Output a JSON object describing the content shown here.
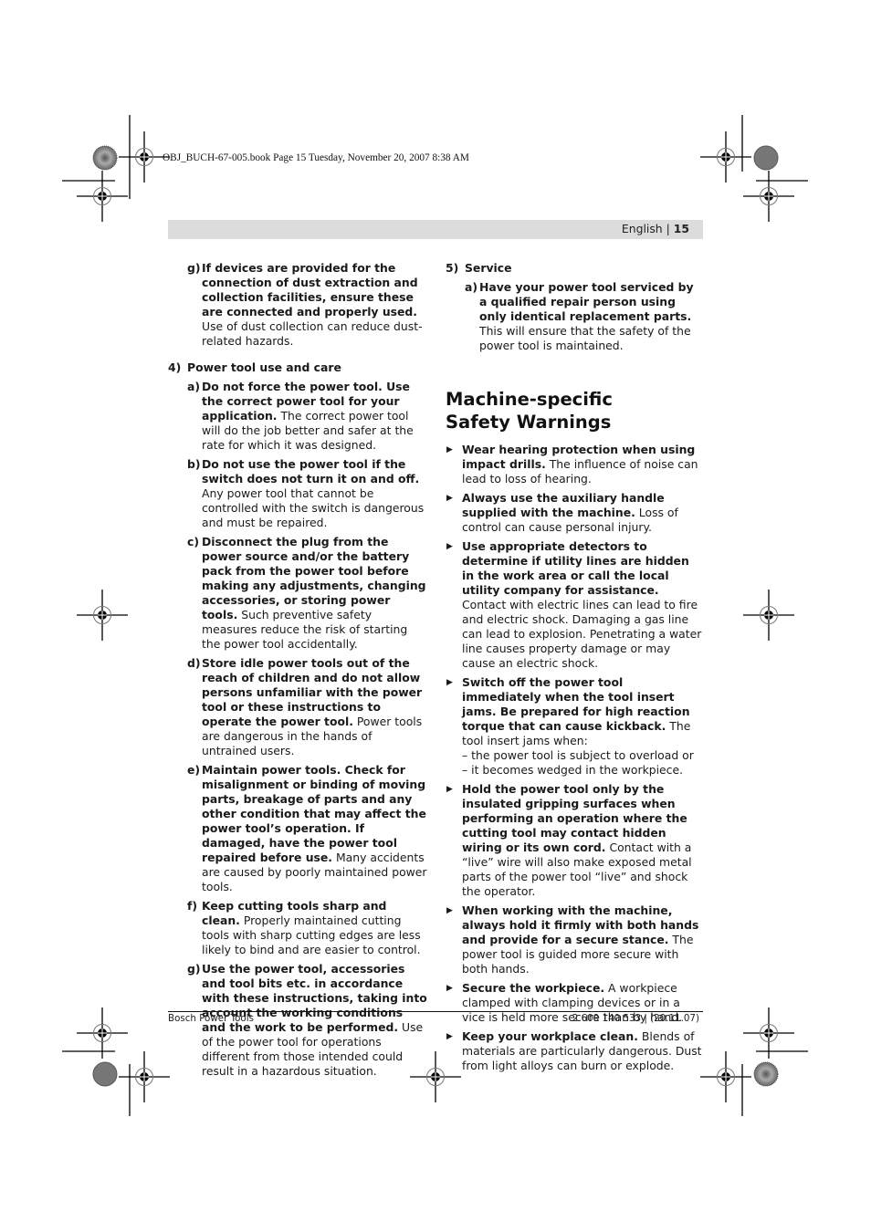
{
  "slug": "OBJ_BUCH-67-005.book  Page 15  Tuesday, November 20, 2007  8:38 AM",
  "header": {
    "language": "English",
    "separator": "|",
    "page_number": "15"
  },
  "left_column": {
    "prev_item": {
      "label": "g)",
      "bold": "If devices are provided for the connec­tion of dust extraction and collection fa­cilities, ensure these are connected and properly used.",
      "text": " Use of dust collection can reduce dust-related hazards."
    },
    "section4": {
      "number": "4)",
      "title": "Power tool use and care",
      "items": [
        {
          "label": "a)",
          "bold": "Do not force the power tool. Use the cor­rect power tool for your application.",
          "text": " The correct power tool will do the job better and safer at the rate for which it was de­signed."
        },
        {
          "label": "b)",
          "bold": "Do not use the power tool if the switch does not turn it on and off.",
          "text": " Any power tool that cannot be controlled with the switch is dangerous and must be re­paired."
        },
        {
          "label": "c)",
          "bold": "Disconnect the plug from the power source and/or the battery pack from the power tool before making any adjust­ments, changing accessories, or storing power tools.",
          "text": " Such preventive safety measures reduce the risk of starting the power tool accidentally."
        },
        {
          "label": "d)",
          "bold": "Store idle power tools out of the reach of children and do not allow persons unfa­miliar with the power tool or these in­structions to operate the power tool.",
          "text": " Power tools are dangerous in the hands of untrained users."
        },
        {
          "label": "e)",
          "bold": "Maintain power tools. Check for mis­alignment or binding of moving parts, breakage of parts and any other condi­tion that may affect the power tool’s op­eration. If damaged, have the power tool repaired before use.",
          "text": " Many accidents are caused by poorly maintained power tools."
        },
        {
          "label": "f)",
          "bold": "Keep cutting tools sharp and clean.",
          "text": " Prop­erly maintained cutting tools with sharp cutting edges are less likely to bind and are easier to control."
        },
        {
          "label": "g)",
          "bold": "Use the power tool, accessories and tool bits etc. in accordance with these in­structions, taking into account the work­ing conditions and the work to be per­formed.",
          "text": " Use of the power tool for operations different from those intended could result in a hazardous situation."
        }
      ]
    }
  },
  "right_column": {
    "section5": {
      "number": "5)",
      "title": "Service",
      "items": [
        {
          "label": "a)",
          "bold": "Have your power tool serviced by a qual­ified repair person using only identical replacement parts.",
          "text": " This will ensure that the safety of the power tool is maintained."
        }
      ]
    },
    "heading_line1": "Machine-specific",
    "heading_line2": "Safety Warnings",
    "bullet_icon": "▶",
    "bullets": [
      {
        "bold": "Wear hearing protection when using impact drills.",
        "text": " The influence of noise can lead to loss of hearing."
      },
      {
        "bold": "Always use the auxiliary handle supplied with the machine.",
        "text": " Loss of control can cause personal injury."
      },
      {
        "bold": "Use appropriate detectors to determine if utility lines are hidden in the work area or call the local utility company for assistance.",
        "text": " Contact with electric lines can lead to fire and electric shock. Damaging a gas line can lead to explosion. Penetrating a water line causes property damage or may cause an electric shock."
      },
      {
        "bold": "Switch off the power tool immediately when the tool insert jams. Be prepared for high reaction torque that can cause kick­back.",
        "text": " The tool insert jams when:",
        "dashes": [
          "– the power tool is subject to overload or",
          "– it becomes wedged in the workpiece."
        ]
      },
      {
        "bold": "Hold the power tool only by the insulated gripping surfaces when performing an oper­ation where the cutting tool may contact hidden wiring or its own cord.",
        "text": " Contact with a “live” wire will also make exposed metal parts of the power tool “live” and shock the operator."
      },
      {
        "bold": "When working with the machine, always hold it firmly with both hands and provide for a secure stance.",
        "text": " The power tool is guided more secure with both hands."
      },
      {
        "bold": "Secure the workpiece.",
        "text": " A workpiece clamped with clamping devices or in a vice is held more secure than by hand."
      },
      {
        "bold": "Keep your workplace clean.",
        "text": " Blends of mate­rials are particularly dangerous. Dust from light alloys can burn or explode."
      }
    ]
  },
  "footer": {
    "left": "Bosch Power Tools",
    "right": "2 609 140 533 | (20.11.07)"
  }
}
